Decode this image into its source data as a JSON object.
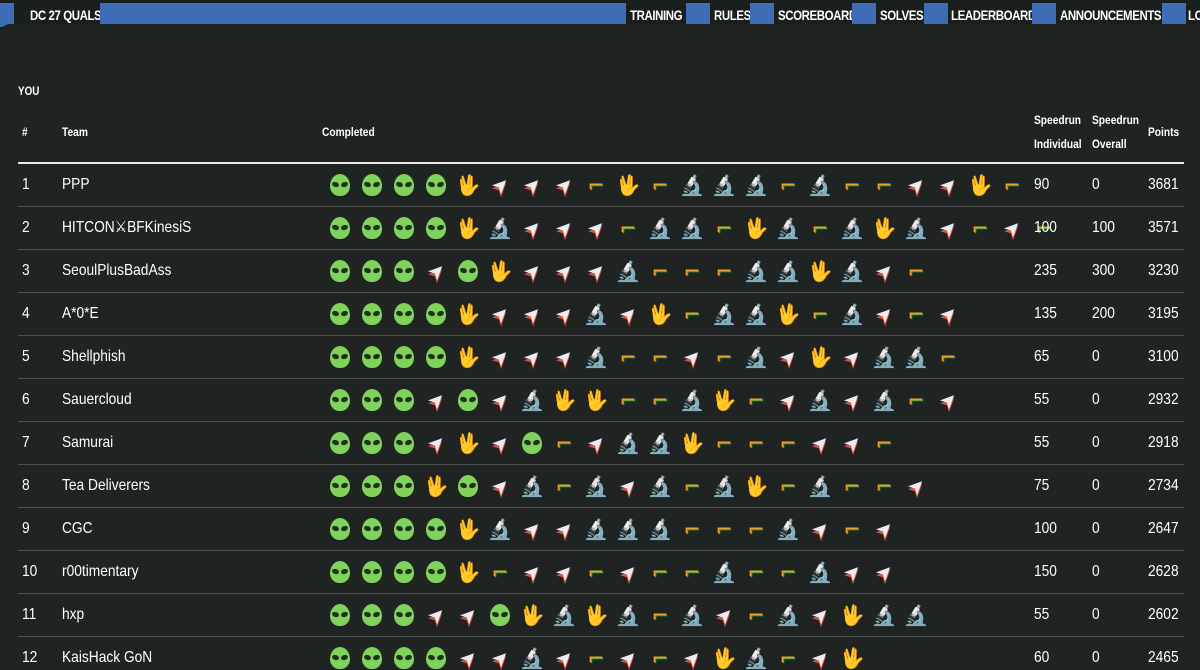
{
  "nav": {
    "brand": "DC 27 QUALS",
    "links": [
      "TRAINING",
      "RULES",
      "SCOREBOARD",
      "SOLVES",
      "LEADERBOARD",
      "ANNOUNCEMENTS",
      "LO"
    ]
  },
  "section_label": "YOU",
  "columns": {
    "rank": "#",
    "team": "Team",
    "completed": "Completed",
    "speedrun_individual": [
      "Speedrun",
      "Individual"
    ],
    "speedrun_overall": [
      "Speedrun",
      "Overall"
    ],
    "points": "Points"
  },
  "icon_glyphs": {
    "alien": "",
    "vulcan": "🖖",
    "rocket": "➤",
    "microscope": "🔬",
    "gun": "⌐"
  },
  "colors": {
    "background": "#1f2422",
    "nav_blue": "#3e6db5",
    "text": "#ffffff"
  },
  "rows": [
    {
      "rank": "1",
      "team": "PPP",
      "individual": "90",
      "overall": "0",
      "points": "3681",
      "icons": [
        "alien",
        "alien",
        "alien",
        "alien",
        "vulcan",
        "rocket",
        "rocket",
        "rocket",
        "gun",
        "vulcan",
        "gun",
        "microscope",
        "microscope",
        "microscope",
        "gun",
        "microscope",
        "gun",
        "gun",
        "rocket",
        "rocket",
        "vulcan",
        "gun"
      ]
    },
    {
      "rank": "2",
      "team": "HITCON⚔BFKinesiS",
      "individual": "100",
      "overall": "100",
      "points": "3571",
      "icons": [
        "alien",
        "alien",
        "alien",
        "alien",
        "vulcan",
        "microscope",
        "rocket",
        "rocket",
        "rocket",
        "gun",
        "microscope",
        "microscope",
        "gun",
        "vulcan",
        "microscope",
        "gun",
        "microscope",
        "vulcan",
        "microscope",
        "rocket",
        "gun",
        "rocket",
        "gun"
      ]
    },
    {
      "rank": "3",
      "team": "SeoulPlusBadAss",
      "individual": "235",
      "overall": "300",
      "points": "3230",
      "icons": [
        "alien",
        "alien",
        "alien",
        "rocket",
        "alien",
        "vulcan",
        "rocket",
        "rocket",
        "rocket",
        "microscope",
        "gun",
        "gun",
        "gun",
        "microscope",
        "microscope",
        "vulcan",
        "microscope",
        "rocket",
        "gun"
      ]
    },
    {
      "rank": "4",
      "team": "A*0*E",
      "individual": "135",
      "overall": "200",
      "points": "3195",
      "icons": [
        "alien",
        "alien",
        "alien",
        "alien",
        "vulcan",
        "rocket",
        "rocket",
        "rocket",
        "microscope",
        "rocket",
        "vulcan",
        "gun",
        "microscope",
        "microscope",
        "vulcan",
        "gun",
        "microscope",
        "rocket",
        "gun",
        "rocket"
      ]
    },
    {
      "rank": "5",
      "team": "Shellphish",
      "individual": "65",
      "overall": "0",
      "points": "3100",
      "icons": [
        "alien",
        "alien",
        "alien",
        "alien",
        "vulcan",
        "rocket",
        "rocket",
        "rocket",
        "microscope",
        "gun",
        "gun",
        "rocket",
        "gun",
        "microscope",
        "rocket",
        "vulcan",
        "rocket",
        "microscope",
        "microscope",
        "gun"
      ]
    },
    {
      "rank": "6",
      "team": "Sauercloud",
      "individual": "55",
      "overall": "0",
      "points": "2932",
      "icons": [
        "alien",
        "alien",
        "alien",
        "rocket",
        "alien",
        "rocket",
        "microscope",
        "vulcan",
        "vulcan",
        "gun",
        "gun",
        "microscope",
        "vulcan",
        "gun",
        "rocket",
        "microscope",
        "rocket",
        "microscope",
        "gun",
        "rocket"
      ]
    },
    {
      "rank": "7",
      "team": "Samurai",
      "individual": "55",
      "overall": "0",
      "points": "2918",
      "icons": [
        "alien",
        "alien",
        "alien",
        "rocket",
        "vulcan",
        "rocket",
        "alien",
        "gun",
        "rocket",
        "microscope",
        "microscope",
        "vulcan",
        "gun",
        "gun",
        "gun",
        "rocket",
        "rocket",
        "gun"
      ]
    },
    {
      "rank": "8",
      "team": "Tea Deliverers",
      "individual": "75",
      "overall": "0",
      "points": "2734",
      "icons": [
        "alien",
        "alien",
        "alien",
        "vulcan",
        "alien",
        "rocket",
        "microscope",
        "gun",
        "microscope",
        "rocket",
        "microscope",
        "gun",
        "microscope",
        "vulcan",
        "gun",
        "microscope",
        "gun",
        "gun",
        "rocket"
      ]
    },
    {
      "rank": "9",
      "team": "CGC",
      "individual": "100",
      "overall": "0",
      "points": "2647",
      "icons": [
        "alien",
        "alien",
        "alien",
        "alien",
        "vulcan",
        "microscope",
        "rocket",
        "rocket",
        "microscope",
        "microscope",
        "microscope",
        "gun",
        "gun",
        "gun",
        "microscope",
        "rocket",
        "gun",
        "rocket"
      ]
    },
    {
      "rank": "10",
      "team": "r00timentary",
      "individual": "150",
      "overall": "0",
      "points": "2628",
      "icons": [
        "alien",
        "alien",
        "alien",
        "alien",
        "vulcan",
        "gun",
        "rocket",
        "rocket",
        "gun",
        "rocket",
        "gun",
        "gun",
        "microscope",
        "gun",
        "gun",
        "microscope",
        "rocket",
        "rocket"
      ]
    },
    {
      "rank": "11",
      "team": "hxp",
      "individual": "55",
      "overall": "0",
      "points": "2602",
      "icons": [
        "alien",
        "alien",
        "alien",
        "rocket",
        "rocket",
        "alien",
        "vulcan",
        "microscope",
        "vulcan",
        "microscope",
        "gun",
        "microscope",
        "rocket",
        "gun",
        "microscope",
        "rocket",
        "vulcan",
        "microscope",
        "microscope"
      ]
    },
    {
      "rank": "12",
      "team": "KaisHack GoN",
      "individual": "60",
      "overall": "0",
      "points": "2465",
      "icons": [
        "alien",
        "alien",
        "alien",
        "alien",
        "rocket",
        "rocket",
        "microscope",
        "rocket",
        "gun",
        "rocket",
        "gun",
        "rocket",
        "vulcan",
        "microscope",
        "gun",
        "rocket",
        "vulcan"
      ]
    }
  ]
}
